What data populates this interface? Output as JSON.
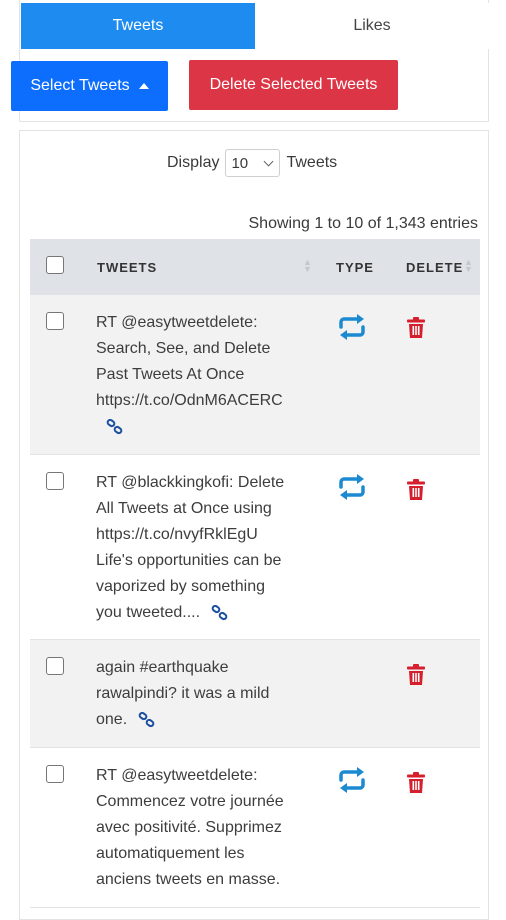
{
  "tabs": [
    {
      "label": "Tweets",
      "active": true
    },
    {
      "label": "Likes",
      "active": false
    }
  ],
  "actions": {
    "select_label": "Select Tweets",
    "delete_label": "Delete Selected Tweets"
  },
  "display": {
    "prefix": "Display",
    "value": "10",
    "suffix": "Tweets"
  },
  "showing": "Showing 1 to 10 of 1,343 entries",
  "columns": {
    "tweets": "TWEETS",
    "type": "TYPE",
    "delete": "DELETE"
  },
  "rows": [
    {
      "lines": [
        "RT @easytweetdelete:",
        "Search, See, and Delete",
        "Past Tweets At Once",
        "https://t.co/OdnM6ACERC"
      ],
      "retweet": true
    },
    {
      "lines": [
        "RT @blackkingkofi: Delete",
        "All Tweets at Once using",
        "https://t.co/nvyfRklEgU",
        "Life's opportunities can be",
        "vaporized by something",
        "you tweeted...."
      ],
      "retweet": true
    },
    {
      "lines": [
        "again #earthquake",
        "rawalpindi? it was a mild",
        "one."
      ],
      "retweet": false
    },
    {
      "lines": [
        "RT @easytweetdelete:",
        "Commencez votre journée",
        "avec positivité. Supprimez",
        "automatiquement les",
        "anciens tweets en masse."
      ],
      "retweet": true
    }
  ],
  "colors": {
    "tab_active": "#1e8bf0",
    "select_button": "#0d6efd",
    "delete_button": "#dc3545",
    "retweet_icon": "#1c8ad0",
    "trash_icon": "#d61f2c"
  }
}
